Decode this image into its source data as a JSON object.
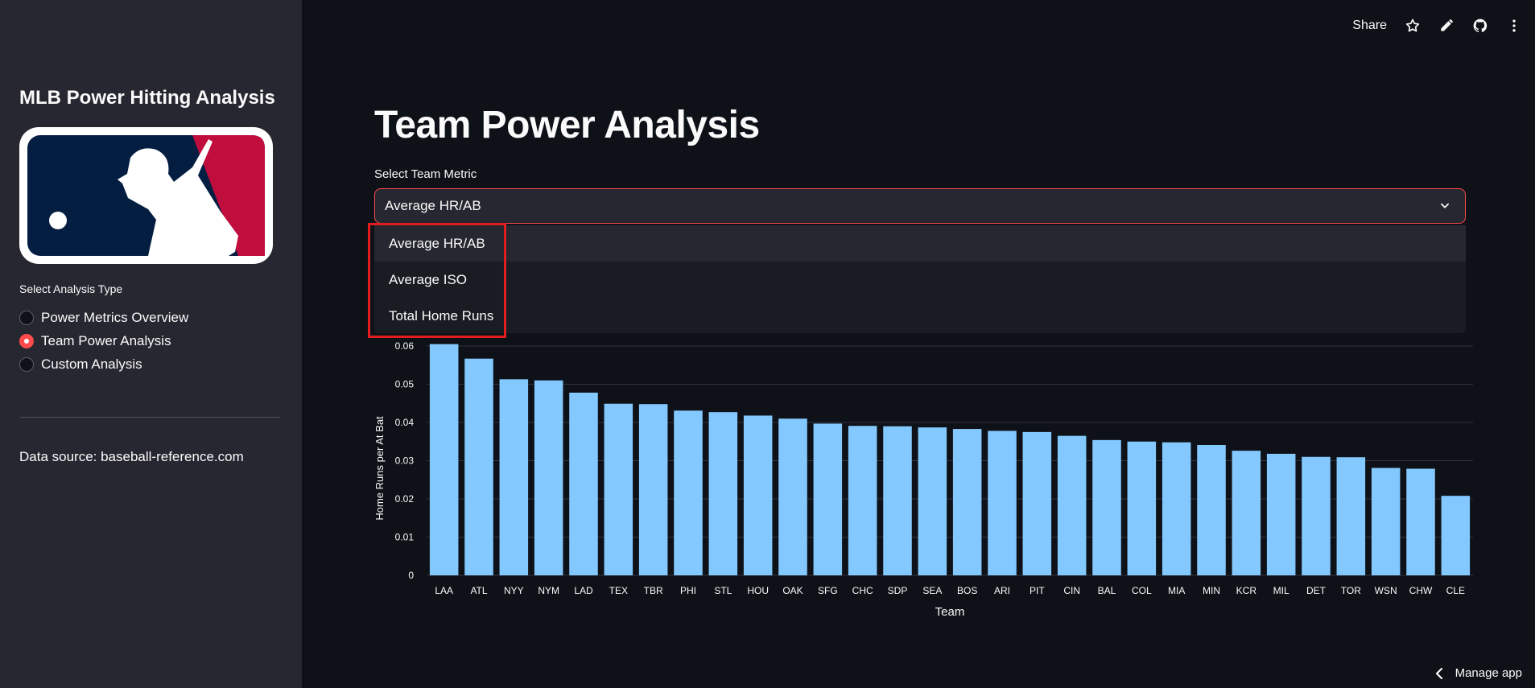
{
  "toolbar": {
    "share_label": "Share"
  },
  "sidebar": {
    "title": "MLB Power Hitting Analysis",
    "radio_label": "Select Analysis Type",
    "options": [
      {
        "label": "Power Metrics Overview",
        "checked": false
      },
      {
        "label": "Team Power Analysis",
        "checked": true
      },
      {
        "label": "Custom Analysis",
        "checked": false
      }
    ],
    "data_source": "Data source: baseball-reference.com"
  },
  "main": {
    "title": "Team Power Analysis",
    "select_label": "Select Team Metric",
    "select_value": "Average HR/AB",
    "dropdown_options": [
      "Average HR/AB",
      "Average ISO",
      "Total Home Runs"
    ]
  },
  "footer": {
    "manage_app": "Manage app"
  },
  "colors": {
    "accent": "#ff4b4b",
    "bar": "#83c9ff",
    "highlight": "#e11d1d"
  },
  "chart_data": {
    "type": "bar",
    "categories": [
      "LAA",
      "ATL",
      "NYY",
      "NYM",
      "LAD",
      "TEX",
      "TBR",
      "PHI",
      "STL",
      "HOU",
      "OAK",
      "SFG",
      "CHC",
      "SDP",
      "SEA",
      "BOS",
      "ARI",
      "PIT",
      "CIN",
      "BAL",
      "COL",
      "MIA",
      "MIN",
      "KCR",
      "MIL",
      "DET",
      "TOR",
      "WSN",
      "CHW",
      "CLE"
    ],
    "values": [
      0.0605,
      0.0567,
      0.0513,
      0.051,
      0.0478,
      0.0449,
      0.0448,
      0.0431,
      0.0427,
      0.0418,
      0.041,
      0.0397,
      0.0391,
      0.039,
      0.0387,
      0.0383,
      0.0378,
      0.0375,
      0.0365,
      0.0354,
      0.035,
      0.0348,
      0.0341,
      0.0326,
      0.0318,
      0.031,
      0.0309,
      0.0281,
      0.0279,
      0.0208
    ],
    "xlabel": "Team",
    "ylabel": "Home Runs per At Bat",
    "yticks": [
      "0",
      "0.01",
      "0.02",
      "0.03",
      "0.04",
      "0.05",
      "0.06"
    ],
    "ylim": [
      0,
      0.06
    ],
    "grid": true
  }
}
